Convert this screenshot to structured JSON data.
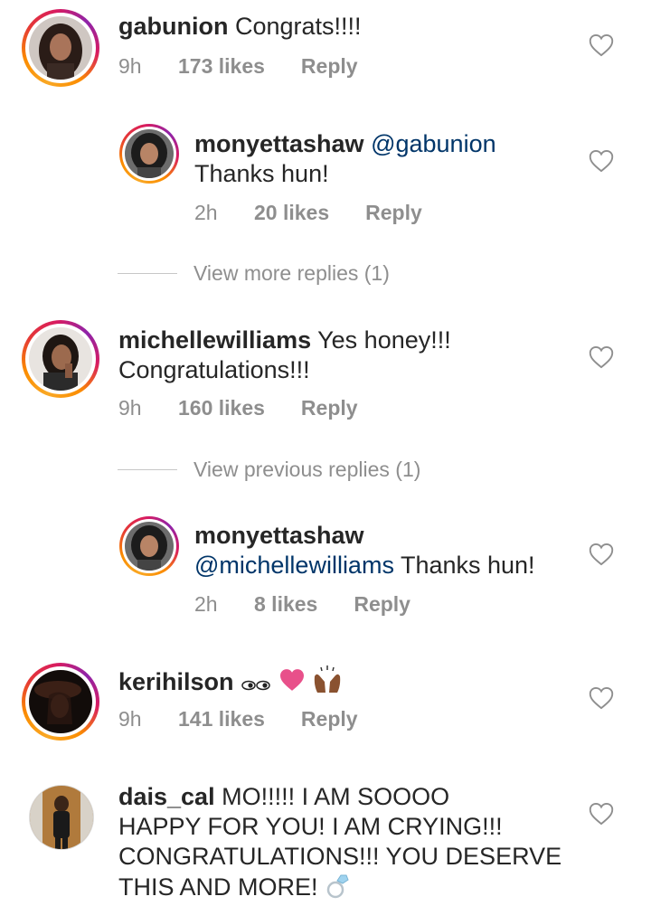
{
  "comments": [
    {
      "username": "gabunion",
      "text": "Congrats!!!!",
      "time": "9h",
      "likes": "173 likes",
      "reply": "Reply"
    },
    {
      "username": "monyettashaw",
      "mention": "@gabunion",
      "text": "Thanks hun!",
      "time": "2h",
      "likes": "20 likes",
      "reply": "Reply"
    },
    {
      "username": "michellewilliams",
      "text_line1": "Yes honey!!!",
      "text_line2": "Congratulations!!!",
      "time": "9h",
      "likes": "160 likes",
      "reply": "Reply"
    },
    {
      "username": "monyettashaw",
      "mention": "@michellewilliams",
      "text": "Thanks hun!",
      "time": "2h",
      "likes": "8 likes",
      "reply": "Reply"
    },
    {
      "username": "kerihilson",
      "emojis": [
        "eyes",
        "pink-heart",
        "raising-hands"
      ],
      "time": "9h",
      "likes": "141 likes",
      "reply": "Reply"
    },
    {
      "username": "dais_cal",
      "text_line1": "MO!!!!! I AM SOOOO",
      "text_line2": "HAPPY FOR YOU!  I AM CRYING!!!",
      "text_line3": "CONGRATULATIONS!!! YOU DESERVE",
      "text_line4": "THIS AND MORE!",
      "emoji": "ring"
    }
  ],
  "view_more_replies": "View more replies (1)",
  "view_previous_replies": "View previous replies (1)",
  "icons": {
    "like": "heart-outline-icon"
  },
  "colors": {
    "text": "#262626",
    "meta": "#8e8e8e",
    "mention": "#003569",
    "heart_pink": "#e8508a"
  }
}
